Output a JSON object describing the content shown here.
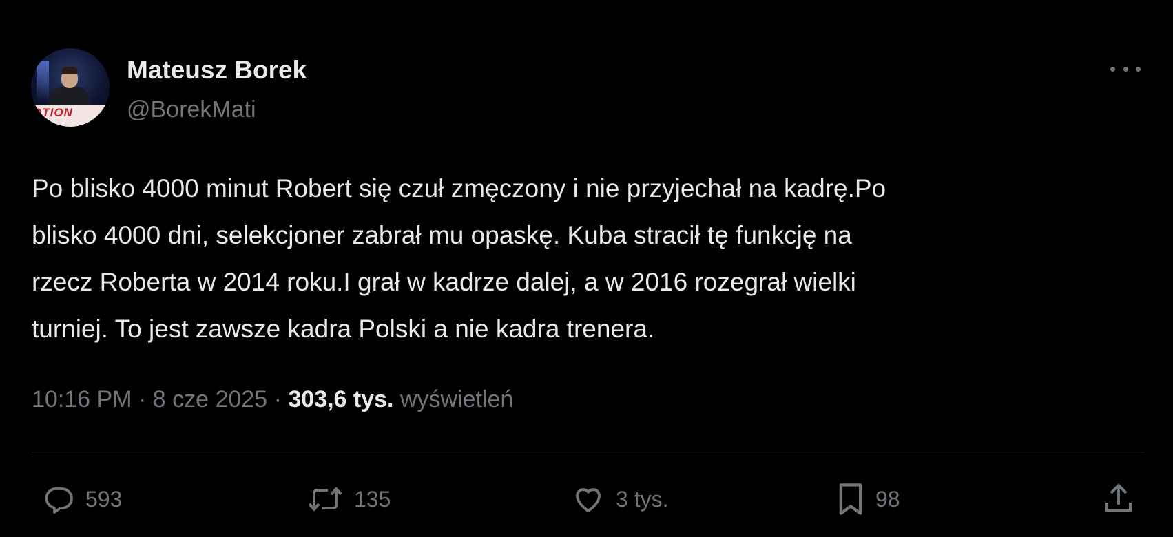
{
  "author": {
    "name": "Mateusz Borek",
    "handle": "@BorekMati",
    "avatar_banner_text": "OTION"
  },
  "tweet": {
    "lines": [
      "Po blisko 4000 minut Robert się czuł zmęczony i nie przyjechał na kadrę.Po",
      "blisko 4000 dni, selekcjoner zabrał mu opaskę. Kuba stracił tę funkcję na",
      "rzecz Roberta w 2014 roku.I grał w kadrze dalej, a w 2016 rozegrał wielki",
      "turniej. To jest zawsze kadra Polski a nie kadra trenera."
    ]
  },
  "meta": {
    "time": "10:16 PM",
    "separator": "·",
    "date": "8 cze 2025",
    "views_count": "303,6 tys.",
    "views_label": "wyświetleń"
  },
  "actions": {
    "replies": "593",
    "reposts": "135",
    "likes": "3 tys.",
    "bookmarks": "98"
  },
  "icons": {
    "more": "more-icon",
    "reply": "reply-icon",
    "repost": "repost-icon",
    "like": "heart-icon",
    "bookmark": "bookmark-icon",
    "share": "share-icon"
  },
  "colors": {
    "background": "#000000",
    "primary_text": "#e7e9ea",
    "secondary_text": "#71767b",
    "divider": "#2f3336"
  }
}
